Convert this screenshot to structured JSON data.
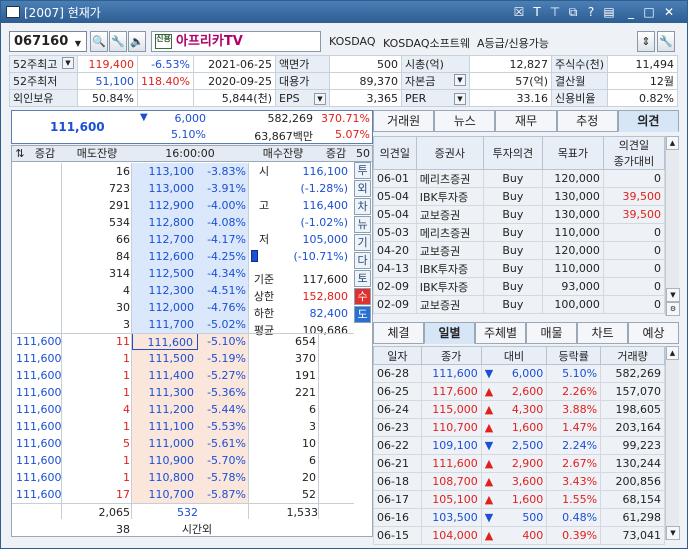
{
  "window": {
    "title": "[2007] 현재가"
  },
  "titlebar_icons": [
    "close-icon",
    "text-icon",
    "pin-icon",
    "popout-icon",
    "help-icon",
    "list-icon",
    "minimize-icon",
    "maximize-icon",
    "close-window-icon"
  ],
  "stock": {
    "code": "067160",
    "name": "아프리카TV",
    "badge": "신용",
    "market": "KOSDAQ",
    "sector": "KOSDAQ소프트웨",
    "grade": "A등급/신용가능"
  },
  "info": [
    [
      "52주최고",
      "119,400",
      "-6.53%",
      "2021-06-25",
      "액면가",
      "500",
      "시총(억)",
      "12,827",
      "주식수(천)",
      "11,494"
    ],
    [
      "52주최저",
      "51,100",
      "118.40%",
      "2020-09-25",
      "대용가",
      "89,370",
      "자본금",
      "57(억)",
      "결산월",
      "12월"
    ],
    [
      "외인보유",
      "50.84%",
      "",
      "5,844(천)",
      "EPS",
      "3,365",
      "PER",
      "33.16",
      "신용비율",
      "0.82%"
    ]
  ],
  "summary": {
    "price": "111,600",
    "change": "6,000",
    "volume": "582,269",
    "vol_ratio": "370.71%",
    "rate": "5.10%",
    "amount": "63,867백만",
    "rate2": "5.07%"
  },
  "orderbook": {
    "headers": [
      "증감",
      "매도잔량",
      "16:00:00",
      "매수잔량",
      "증감"
    ],
    "asks": [
      [
        "16",
        "113,100",
        "-3.83%"
      ],
      [
        "723",
        "113,000",
        "-3.91%"
      ],
      [
        "291",
        "112,900",
        "-4.00%"
      ],
      [
        "534",
        "112,800",
        "-4.08%"
      ],
      [
        "66",
        "112,700",
        "-4.17%"
      ],
      [
        "84",
        "112,600",
        "-4.25%"
      ],
      [
        "314",
        "112,500",
        "-4.34%"
      ],
      [
        "4",
        "112,300",
        "-4.51%"
      ],
      [
        "30",
        "112,000",
        "-4.76%"
      ],
      [
        "3",
        "111,700",
        "-5.02%"
      ]
    ],
    "bids": [
      [
        "111,600",
        "11",
        "111,600",
        "-5.10%",
        "654"
      ],
      [
        "111,600",
        "1",
        "111,500",
        "-5.19%",
        "370"
      ],
      [
        "111,600",
        "1",
        "111,400",
        "-5.27%",
        "191"
      ],
      [
        "111,600",
        "1",
        "111,300",
        "-5.36%",
        "221"
      ],
      [
        "111,600",
        "4",
        "111,200",
        "-5.44%",
        "6"
      ],
      [
        "111,600",
        "1",
        "111,100",
        "-5.53%",
        "3"
      ],
      [
        "111,600",
        "5",
        "111,000",
        "-5.61%",
        "10"
      ],
      [
        "111,600",
        "1",
        "110,900",
        "-5.70%",
        "6"
      ],
      [
        "111,600",
        "1",
        "110,800",
        "-5.78%",
        "20"
      ],
      [
        "111,600",
        "17",
        "110,700",
        "-5.87%",
        "52"
      ]
    ],
    "side_labels": [
      [
        "시",
        "116,100"
      ],
      [
        "",
        "(-1.28%)"
      ],
      [
        "고",
        "116,400"
      ],
      [
        "",
        "(-1.02%)"
      ],
      [
        "저",
        "105,000"
      ],
      [
        "",
        "(-10.71%)"
      ],
      [
        "기준",
        "117,600"
      ],
      [
        "상한",
        "152,800"
      ],
      [
        "하한",
        "82,400"
      ],
      [
        "평균",
        "109,686"
      ]
    ],
    "totals": {
      "ask": "2,065",
      "mid": "532",
      "bid": "1,533"
    },
    "after": {
      "value": "38",
      "label": "시간외"
    },
    "vtabs": [
      "투",
      "외",
      "차",
      "뉴",
      "기",
      "다",
      "토",
      "수",
      "도"
    ]
  },
  "opinion_tabs": [
    "거래원",
    "뉴스",
    "재무",
    "추정",
    "의견"
  ],
  "opinion_headers": [
    "의견일",
    "증권사",
    "투자의견",
    "목표가",
    "의견일\n종가대비"
  ],
  "opinions": [
    [
      "06-01",
      "메리츠증권",
      "Buy",
      "120,000",
      "0"
    ],
    [
      "05-04",
      "IBK투자증",
      "Buy",
      "130,000",
      "39,500"
    ],
    [
      "05-04",
      "교보증권",
      "Buy",
      "130,000",
      "39,500"
    ],
    [
      "05-03",
      "메리츠증권",
      "Buy",
      "110,000",
      "0"
    ],
    [
      "04-20",
      "교보증권",
      "Buy",
      "120,000",
      "0"
    ],
    [
      "04-13",
      "IBK투자증",
      "Buy",
      "110,000",
      "0"
    ],
    [
      "02-09",
      "IBK투자증",
      "Buy",
      "93,000",
      "0"
    ],
    [
      "02-09",
      "교보증권",
      "Buy",
      "100,000",
      "0"
    ]
  ],
  "daily_tabs": [
    "체결",
    "일별",
    "주체별",
    "매물",
    "차트",
    "예상"
  ],
  "daily_headers": [
    "일자",
    "종가",
    "대비",
    "등락률",
    "거래량"
  ],
  "daily": [
    [
      "06-28",
      "111,600",
      "▼",
      "6,000",
      "5.10%",
      "582,269",
      "d"
    ],
    [
      "06-25",
      "117,600",
      "▲",
      "2,600",
      "2.26%",
      "157,070",
      "u"
    ],
    [
      "06-24",
      "115,000",
      "▲",
      "4,300",
      "3.88%",
      "198,605",
      "u"
    ],
    [
      "06-23",
      "110,700",
      "▲",
      "1,600",
      "1.47%",
      "203,164",
      "u"
    ],
    [
      "06-22",
      "109,100",
      "▼",
      "2,500",
      "2.24%",
      "99,223",
      "d"
    ],
    [
      "06-21",
      "111,600",
      "▲",
      "2,900",
      "2.67%",
      "130,244",
      "u"
    ],
    [
      "06-18",
      "108,700",
      "▲",
      "3,600",
      "3.43%",
      "200,856",
      "u"
    ],
    [
      "06-17",
      "105,100",
      "▲",
      "1,600",
      "1.55%",
      "68,154",
      "u"
    ],
    [
      "06-16",
      "103,500",
      "▼",
      "500",
      "0.48%",
      "61,298",
      "d"
    ],
    [
      "06-15",
      "104,000",
      "▲",
      "400",
      "0.39%",
      "73,041",
      "u"
    ]
  ],
  "colors": {
    "up": "#e0201c",
    "down": "#1a4fd6",
    "title": "#2d5d92"
  }
}
